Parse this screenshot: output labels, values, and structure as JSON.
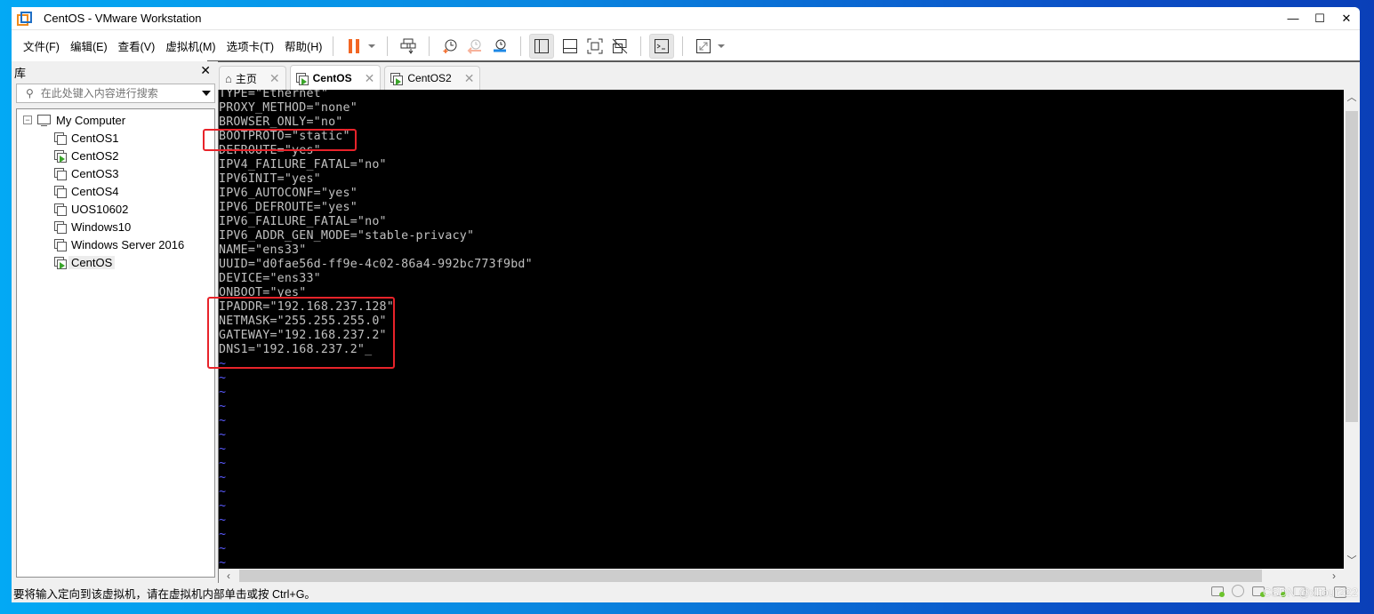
{
  "window": {
    "title": "CentOS  - VMware Workstation",
    "controls": {
      "minimize": "—",
      "maximize": "☐",
      "close": "✕"
    }
  },
  "menubar": {
    "items": [
      "文件(F)",
      "编辑(E)",
      "查看(V)",
      "虚拟机(M)",
      "选项卡(T)",
      "帮助(H)"
    ]
  },
  "toolbar": {
    "buttons": [
      {
        "name": "pause",
        "icon": "pause-icon",
        "color": "#f26522"
      },
      {
        "name": "send-ctrl-alt-del",
        "icon": "send-keys-icon"
      },
      {
        "name": "take-snapshot",
        "icon": "snapshot-take-icon"
      },
      {
        "name": "revert-snapshot",
        "icon": "snapshot-revert-icon"
      },
      {
        "name": "snapshot-manager",
        "icon": "snapshot-manager-icon"
      },
      {
        "name": "show-library",
        "icon": "library-view-icon",
        "active": true
      },
      {
        "name": "show-thumbnail-bar",
        "icon": "thumbnail-bar-icon"
      },
      {
        "name": "full-screen",
        "icon": "full-screen-icon"
      },
      {
        "name": "unity",
        "icon": "unity-icon"
      },
      {
        "name": "console-view",
        "icon": "console-view-icon",
        "active": true
      },
      {
        "name": "stretch-guest",
        "icon": "stretch-icon"
      }
    ]
  },
  "library": {
    "title": "库",
    "close": "✕",
    "search_placeholder": "在此处键入内容进行搜索",
    "root": "My Computer",
    "vms": [
      {
        "name": "CentOS1",
        "running": false
      },
      {
        "name": "CentOS2",
        "running": true
      },
      {
        "name": "CentOS3",
        "running": false
      },
      {
        "name": "CentOS4",
        "running": false
      },
      {
        "name": "UOS10602",
        "running": false
      },
      {
        "name": "Windows10",
        "running": false
      },
      {
        "name": "Windows Server 2016",
        "running": false
      },
      {
        "name": "CentOS",
        "running": true,
        "selected": true
      }
    ]
  },
  "tabs": [
    {
      "label": "主页",
      "icon": "home-icon",
      "active": false
    },
    {
      "label": "CentOS",
      "icon": "vm-running-icon",
      "active": true
    },
    {
      "label": "CentOS2",
      "icon": "vm-running-icon",
      "active": false
    }
  ],
  "console": {
    "lines": [
      "TYPE=\"Ethernet\"",
      "PROXY_METHOD=\"none\"",
      "BROWSER_ONLY=\"no\"",
      "BOOTPROTO=\"static\"",
      "DEFROUTE=\"yes\"",
      "IPV4_FAILURE_FATAL=\"no\"",
      "IPV6INIT=\"yes\"",
      "IPV6_AUTOCONF=\"yes\"",
      "IPV6_DEFROUTE=\"yes\"",
      "IPV6_FAILURE_FATAL=\"no\"",
      "IPV6_ADDR_GEN_MODE=\"stable-privacy\"",
      "NAME=\"ens33\"",
      "UUID=\"d0fae56d-ff9e-4c02-86a4-992bc773f9bd\"",
      "DEVICE=\"ens33\"",
      "ONBOOT=\"yes\"",
      "IPADDR=\"192.168.237.128\"",
      "NETMASK=\"255.255.255.0\"",
      "GATEWAY=\"192.168.237.2\"",
      "DNS1=\"192.168.237.2\""
    ],
    "cursor": "_",
    "tilde_lines": 15,
    "tilde": "~",
    "highlight_color": "#e8232a"
  },
  "statusbar": {
    "message": "要将输入定向到该虚拟机，请在虚拟机内部单击或按 Ctrl+G。",
    "devices": [
      "hard-disk",
      "cd-dvd",
      "network-adapter",
      "sound-card",
      "usb-controller",
      "printer",
      "display"
    ]
  },
  "watermark": "CSDN @xltour222"
}
